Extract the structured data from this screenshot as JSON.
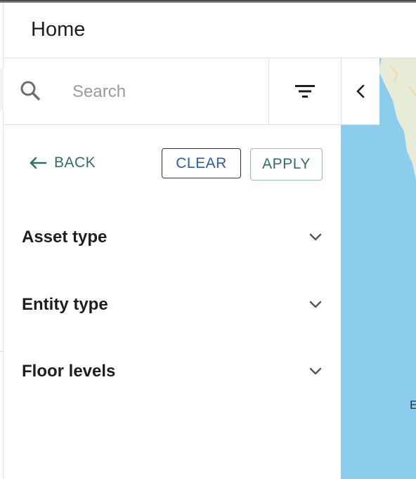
{
  "header": {
    "title": "Home"
  },
  "search": {
    "placeholder": "Search"
  },
  "filter_panel": {
    "back_label": "BACK",
    "clear_label": "CLEAR",
    "apply_label": "APPLY",
    "sections": [
      {
        "label": "Asset type"
      },
      {
        "label": "Entity type"
      },
      {
        "label": "Floor levels"
      }
    ]
  },
  "map": {
    "partial_label": "E"
  },
  "colors": {
    "accent_teal": "#2f6f6a",
    "clear_blue": "#2a5ba8",
    "map_water": "#8ccdee",
    "map_land": "#e6ecd6"
  },
  "icons": {
    "search": "search-icon",
    "filter": "filter-icon",
    "collapse": "chevron-left-icon",
    "back": "arrow-left-icon",
    "expand": "chevron-down-icon"
  }
}
